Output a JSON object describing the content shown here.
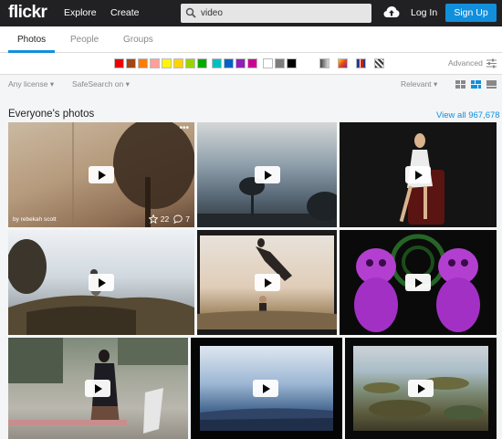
{
  "header": {
    "logo": "flickr",
    "nav": [
      "Explore",
      "Create"
    ],
    "search_value": "video",
    "login": "Log In",
    "signup": "Sign Up"
  },
  "tabs": [
    "Photos",
    "People",
    "Groups"
  ],
  "colors": {
    "accent": "#128fdc",
    "topbar": "#212124",
    "swatches": [
      "#ed0000",
      "#a24615",
      "#ff7c00",
      "#ff9f9c",
      "#fff600",
      "#ffd4a5",
      "#00ab00",
      "#00bfbf",
      "#0062c6",
      "#8c20ba",
      "#cb0194",
      "#ffffff",
      "#7c7c7c",
      "#000000"
    ]
  },
  "filters": {
    "advanced": "Advanced",
    "license": "Any license",
    "safesearch": "SafeSearch on",
    "relevant": "Relevant"
  },
  "results": {
    "title": "Everyone's photos",
    "view_all": "View all 967,678"
  },
  "first_photo": {
    "by": "by rebekah scott",
    "faves": "22",
    "comments": "7"
  },
  "icons": [
    "search-icon",
    "upload-cloud-icon",
    "advanced-settings-icon",
    "more-icon",
    "star-icon",
    "comment-icon",
    "play-icon"
  ]
}
